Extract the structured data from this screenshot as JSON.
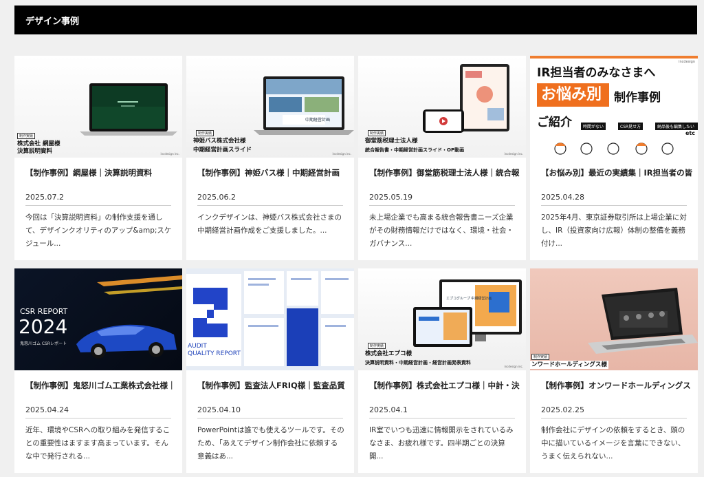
{
  "header": {
    "title": "デザイン事例"
  },
  "cards": [
    {
      "title": "【制作事例】網屋様｜決算説明資料",
      "date": "2025.07.2",
      "excerpt": "今回は「決算説明資料」の制作支援を通して、デザインクオリティのアップ&amp;スケジュール...",
      "thumb": {
        "tag": "制作実績",
        "caption1": "株式会社 網屋様",
        "caption2": "決算説明資料",
        "brand": "incdesign inc."
      }
    },
    {
      "title": "【制作事例】神姫バス様｜中期経営計画",
      "date": "2025.06.2",
      "excerpt": "インクデザインは、神姫バス株式会社さまの中期経営計画作成をご支援しました。...",
      "thumb": {
        "tag": "制作実績",
        "caption1": "神姫バス株式会社様",
        "caption2": "中期経営計画スライド",
        "brand": "incdesign inc.",
        "screen": "中期経営計画"
      }
    },
    {
      "title": "【制作事例】御堂筋税理士法人様｜統合報",
      "date": "2025.05.19",
      "excerpt": "未上場企業でも高まる統合報告書ニーズ企業がその財務情報だけではなく、環境・社会・ガバナンス...",
      "thumb": {
        "tag": "制作実績",
        "caption1": "御堂筋税理士法人様",
        "caption2": "統合報告書・中期経営計画スライド・OP動画",
        "brand": "incdesign inc."
      }
    },
    {
      "title": "【お悩み別】最近の実績集｜IR担当者の皆",
      "date": "2025.04.28",
      "excerpt": "2025年4月、東京証券取引所は上場企業に対し、IR（投資家向け広報）体制の整備を義務付け...",
      "thumb": {
        "brand": "incdesign",
        "line1": "IR担当者のみなさまへ",
        "highlight": "お悩み別",
        "line2": "制作事例",
        "line3": "ご紹介",
        "chips": [
          "時間がない",
          "CSR見せ方",
          "納品後も編集したい"
        ],
        "etc": "etc"
      }
    },
    {
      "title": "【制作事例】鬼怒川ゴム工業株式会社様｜",
      "date": "2025.04.24",
      "excerpt": "近年、環境やCSRへの取り組みを発信することの重要性はますます高まっています。そんな中で発行される...",
      "thumb": {
        "line1": "CSR REPORT",
        "line2": "2024",
        "line3": "鬼怒川ゴム CSRレポート"
      }
    },
    {
      "title": "【制作事例】監査法人FRIQ様｜監査品質",
      "date": "2025.04.10",
      "excerpt": "PowerPointは誰でも使えるツールです。そのため、「あえてデザイン制作会社に依頼する意義はあ...",
      "thumb": {
        "line1": "AUDIT",
        "line2": "QUALITY REPORT"
      }
    },
    {
      "title": "【制作事例】株式会社エプコ様｜中計・決",
      "date": "2025.04.1",
      "excerpt": "IR室でいつも迅速に情報開示をされているみなさま、お疲れ様です。四半期ごとの決算開...",
      "thumb": {
        "tag": "制作実績",
        "caption1": "株式会社エプコ様",
        "caption2": "決算説明資料・中期経営計画・経営計画発表資料",
        "brand": "incdesign inc.",
        "screen": "エプコグループ 中期経営計画"
      }
    },
    {
      "title": "【制作事例】オンワードホールディングス",
      "date": "2025.02.25",
      "excerpt": "制作会社にデザインの依頼をするとき、頭の中に描いているイメージを言葉にできない、うまく伝えられない...",
      "thumb": {
        "tag": "制作実績",
        "caption1": "ンワードホールディングス様",
        "caption2": ""
      }
    }
  ]
}
